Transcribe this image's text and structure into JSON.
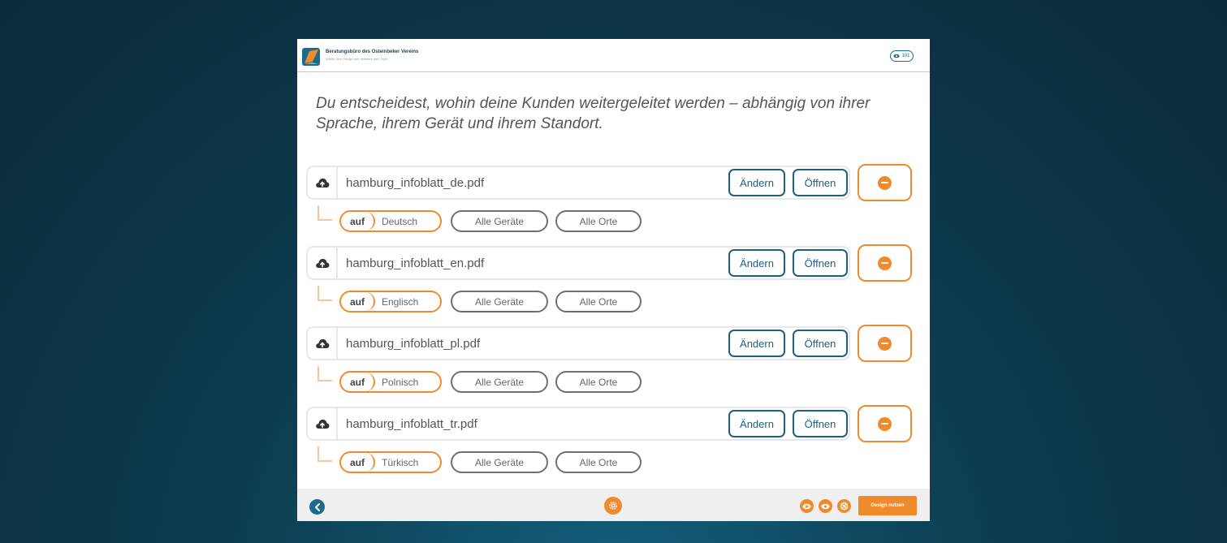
{
  "header": {
    "org_name": "Beratungsbüro des Osteinbeker Vereins",
    "org_subtitle": "Wähle dein Design und definiere dein Style",
    "views_count": "101"
  },
  "headline": "Du entscheidest, wohin deine Kunden weitergeleitet werden – abhängig von ihrer Sprache, ihrem Gerät und ihrem Standort.",
  "rules": [
    {
      "file": "hamburg_infoblatt_de.pdf",
      "change_label": "Ändern",
      "open_label": "Öffnen",
      "auf_label": "auf",
      "language": "Deutsch",
      "devices": "Alle Geräte",
      "places": "Alle Orte"
    },
    {
      "file": "hamburg_infoblatt_en.pdf",
      "change_label": "Ändern",
      "open_label": "Öffnen",
      "auf_label": "auf",
      "language": "Englisch",
      "devices": "Alle Geräte",
      "places": "Alle Orte"
    },
    {
      "file": "hamburg_infoblatt_pl.pdf",
      "change_label": "Ändern",
      "open_label": "Öffnen",
      "auf_label": "auf",
      "language": "Polnisch",
      "devices": "Alle Geräte",
      "places": "Alle Orte"
    },
    {
      "file": "hamburg_infoblatt_tr.pdf",
      "change_label": "Ändern",
      "open_label": "Öffnen",
      "auf_label": "auf",
      "language": "Türkisch",
      "devices": "Alle Geräte",
      "places": "Alle Orte"
    }
  ],
  "footer": {
    "use_design_label": "Design nutzen",
    "icons": [
      "chevron-left-icon",
      "settings-icon",
      "eye-icon",
      "eye-icon",
      "reset-icon"
    ]
  },
  "colors": {
    "accent": "#ef8b2c",
    "primary": "#1d6a8c",
    "background": "#0d3c50"
  }
}
